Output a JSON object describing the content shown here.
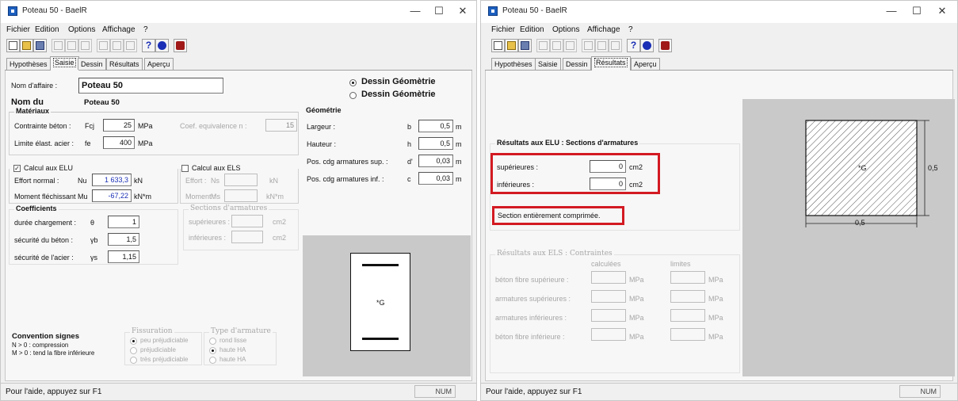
{
  "left_window": {
    "title": "Poteau 50 - BaelR",
    "menu": [
      "Fichier",
      "Edition",
      "Options",
      "Affichage",
      "?"
    ],
    "tabs": [
      "Hypothèses",
      "Saisie",
      "Dessin",
      "Résultats",
      "Aperçu"
    ],
    "active_tab": "Saisie",
    "nom_affaire_label": "Nom d'affaire :",
    "nom_affaire_value": "Poteau 50",
    "nom_du_label": "Nom du",
    "nom_du_value": "Poteau 50",
    "radio_dessin_1": "Dessin Géomètrie",
    "radio_dessin_2": "Dessin Géomètrie",
    "materiaux": {
      "title": "Matériaux",
      "contrainte_label": "Contrainte béton :",
      "contrainte_sym": "Fcj",
      "contrainte_value": "25",
      "contrainte_unit": "MPa",
      "coef_label": "Coef. equivalence n :",
      "coef_value": "15",
      "limite_label": "Limite élast. acier :",
      "limite_sym": "fe",
      "limite_value": "400",
      "limite_unit": "MPa"
    },
    "geometrie": {
      "title": "Géométrie",
      "largeur_label": "Largeur :",
      "largeur_sym": "b",
      "largeur_value": "0,5",
      "largeur_unit": "m",
      "hauteur_label": "Hauteur :",
      "hauteur_sym": "h",
      "hauteur_value": "0,5",
      "hauteur_unit": "m",
      "sup_label": "Pos. cdg armatures sup. :",
      "sup_sym": "d'",
      "sup_value": "0,03",
      "sup_unit": "m",
      "inf_label": "Pos. cdg armatures inf. :",
      "inf_sym": "c",
      "inf_value": "0,03",
      "inf_unit": "m"
    },
    "elu": {
      "title": "Calcul aux ELU",
      "effort_label": "Effort normal :",
      "effort_sym": "Nu",
      "effort_value": "1 633,3",
      "effort_unit": "kN",
      "moment_label": "Moment fléchissant",
      "moment_sym": "Mu",
      "moment_value": "-67,22",
      "moment_unit": "kN*m"
    },
    "els": {
      "title": "Calcul aux ELS",
      "effort_label": "Effort :",
      "effort_sym": "Ns",
      "effort_unit": "kN",
      "moment_label": "Moment :",
      "moment_sym": "Ms",
      "moment_unit": "kN*m",
      "sections_title": "Sections d'armatures",
      "sup_label": "supérieures :",
      "sup_unit": "cm2",
      "inf_label": "inférieures :",
      "inf_unit": "cm2"
    },
    "coefficients": {
      "title": "Coefficients",
      "duree_label": "durée chargement :",
      "duree_sym": "θ",
      "duree_value": "1",
      "beton_label": "sécurité du béton :",
      "beton_sym": "γb",
      "beton_value": "1,5",
      "acier_label": "sécurité de l'acier :",
      "acier_sym": "γs",
      "acier_value": "1,15"
    },
    "convention": {
      "title": "Convention signes",
      "line1": "N > 0 : compression",
      "line2": "M > 0 : tend la fibre inférieure"
    },
    "fissuration": {
      "title": "Fissuration",
      "options": [
        "peu préjudiciable",
        "préjudiciable",
        "très préjudiciable"
      ]
    },
    "type_armature": {
      "title": "Type d'armature",
      "options": [
        "rond lisse",
        "haute HA",
        "haute HA"
      ]
    },
    "preview_label": "*G",
    "status": "Pour l'aide, appuyez sur F1",
    "num": "NUM"
  },
  "right_window": {
    "title": "Poteau 50 - BaelR",
    "menu": [
      "Fichier",
      "Edition",
      "Options",
      "Affichage",
      "?"
    ],
    "tabs": [
      "Hypothèses",
      "Saisie",
      "Dessin",
      "Résultats",
      "Aperçu"
    ],
    "active_tab": "Résultats",
    "elu_title": "Résultats aux ELU : Sections d'armatures",
    "sup_label": "supérieures :",
    "sup_value": "0",
    "sup_unit": "cm2",
    "inf_label": "inférieures :",
    "inf_value": "0",
    "inf_unit": "cm2",
    "section_text": "Section entièrement comprimée.",
    "els_title": "Résultats aux ELS : Contraintes",
    "els_col1": "calculées",
    "els_col2": "limites",
    "els_rows": [
      "béton fibre supérieure :",
      "armatures supérieures :",
      "armatures inférieures :",
      "béton fibre inférieure :"
    ],
    "els_unit": "MPa",
    "drawing": {
      "center_label": "*G",
      "dim_width": "0,5",
      "dim_height": "0,5"
    },
    "status": "Pour l'aide, appuyez sur F1",
    "num": "NUM"
  },
  "colors": {
    "highlight": "#d31a22",
    "value_blue": "#1a2fb5",
    "preview_bg": "#c9c9c9"
  }
}
